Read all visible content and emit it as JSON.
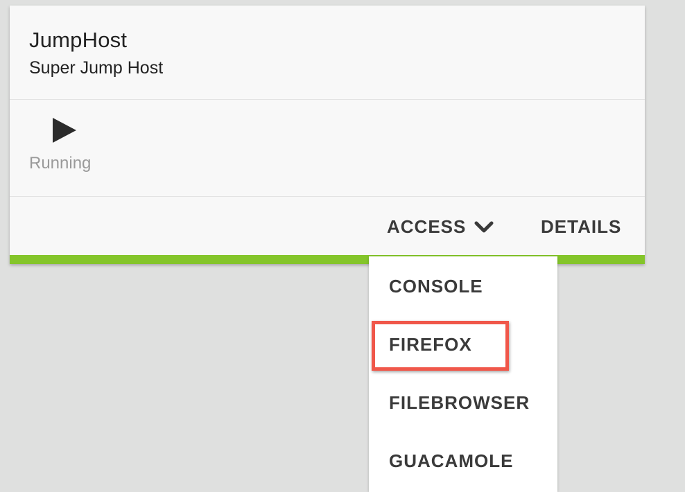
{
  "card": {
    "title": "JumpHost",
    "subtitle": "Super Jump Host",
    "status": {
      "icon": "play-icon",
      "label": "Running"
    },
    "actions": {
      "access_label": "ACCESS",
      "details_label": "DETAILS"
    },
    "accent_color": "#84c52a"
  },
  "dropdown": {
    "items": [
      {
        "label": "CONSOLE"
      },
      {
        "label": "FIREFOX",
        "highlighted": true
      },
      {
        "label": "FILEBROWSER"
      },
      {
        "label": "GUACAMOLE"
      }
    ],
    "highlight_color": "#f0574a"
  }
}
